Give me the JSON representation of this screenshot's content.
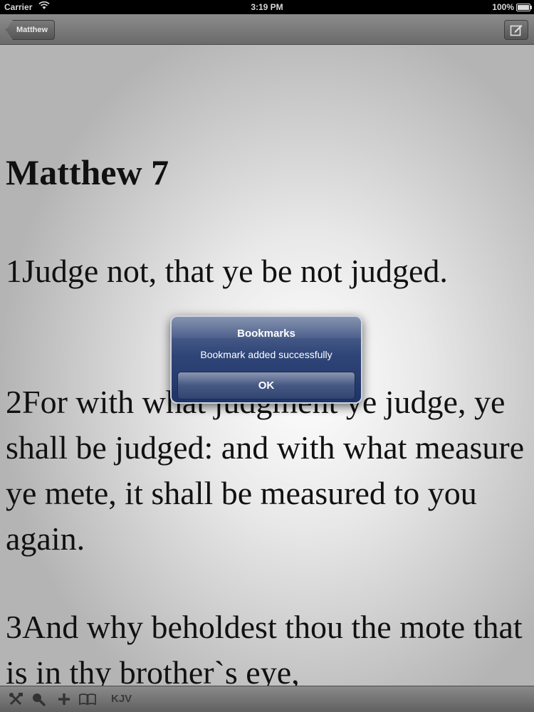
{
  "status_bar": {
    "carrier": "Carrier",
    "time": "3:19 PM",
    "battery": "100%"
  },
  "nav": {
    "back_label": "Matthew",
    "compose_icon": "compose-icon"
  },
  "content": {
    "chapter_title": "Matthew 7",
    "verses": [
      "1Judge not, that ye be not judged.",
      "2For with what judgment ye judge, ye shall be judged: and with what measure ye mete, it shall be measured to you again.",
      "3And why beholdest thou the mote that is in thy brother`s eye,"
    ]
  },
  "alert": {
    "title": "Bookmarks",
    "message": "Bookmark added successfully",
    "ok_label": "OK"
  },
  "toolbar": {
    "icons": [
      "tools-icon",
      "search-icon",
      "add-icon",
      "book-icon"
    ],
    "version_label": "KJV"
  }
}
